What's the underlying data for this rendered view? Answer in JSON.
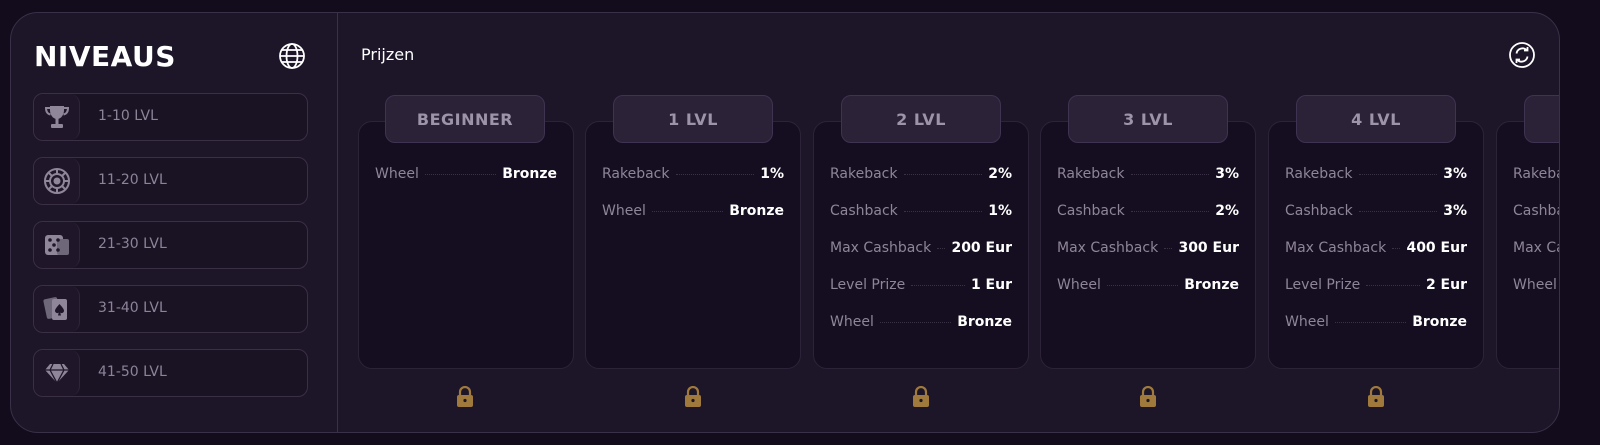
{
  "sidebar": {
    "title": "NIVEAUS",
    "globe_icon": "globe-icon",
    "items": [
      {
        "label": "1-10 LVL",
        "icon": "trophy-icon"
      },
      {
        "label": "11-20 LVL",
        "icon": "roulette-wheel-icon"
      },
      {
        "label": "21-30 LVL",
        "icon": "dice-icon"
      },
      {
        "label": "31-40 LVL",
        "icon": "playing-cards-icon"
      },
      {
        "label": "41-50 LVL",
        "icon": "diamond-icon"
      }
    ]
  },
  "main": {
    "title": "Prijzen",
    "refresh_icon": "refresh-icon",
    "levels": [
      {
        "name": "BEGINNER",
        "rows": [
          {
            "key": "Wheel",
            "value": "Bronze"
          }
        ]
      },
      {
        "name": "1 LVL",
        "rows": [
          {
            "key": "Rakeback",
            "value": "1%"
          },
          {
            "key": "Wheel",
            "value": "Bronze"
          }
        ]
      },
      {
        "name": "2 LVL",
        "rows": [
          {
            "key": "Rakeback",
            "value": "2%"
          },
          {
            "key": "Cashback",
            "value": "1%"
          },
          {
            "key": "Max Cashback",
            "value": "200 Eur"
          },
          {
            "key": "Level Prize",
            "value": "1 Eur"
          },
          {
            "key": "Wheel",
            "value": "Bronze"
          }
        ]
      },
      {
        "name": "3 LVL",
        "rows": [
          {
            "key": "Rakeback",
            "value": "3%"
          },
          {
            "key": "Cashback",
            "value": "2%"
          },
          {
            "key": "Max Cashback",
            "value": "300 Eur"
          },
          {
            "key": "Wheel",
            "value": "Bronze"
          }
        ]
      },
      {
        "name": "4 LVL",
        "rows": [
          {
            "key": "Rakeback",
            "value": "3%"
          },
          {
            "key": "Cashback",
            "value": "3%"
          },
          {
            "key": "Max Cashback",
            "value": "400 Eur"
          },
          {
            "key": "Level Prize",
            "value": "2 Eur"
          },
          {
            "key": "Wheel",
            "value": "Bronze"
          }
        ]
      },
      {
        "name": "",
        "rows": [
          {
            "key": "Rakeback",
            "value": ""
          },
          {
            "key": "Cashback",
            "value": ""
          },
          {
            "key": "Max Cashback",
            "value": ""
          },
          {
            "key": "Wheel",
            "value": ""
          }
        ]
      }
    ],
    "lock_icon": "lock-icon",
    "colors": {
      "lock": "#a07a3c",
      "accent_text": "#ffffff",
      "muted_text": "#8e8599"
    }
  }
}
